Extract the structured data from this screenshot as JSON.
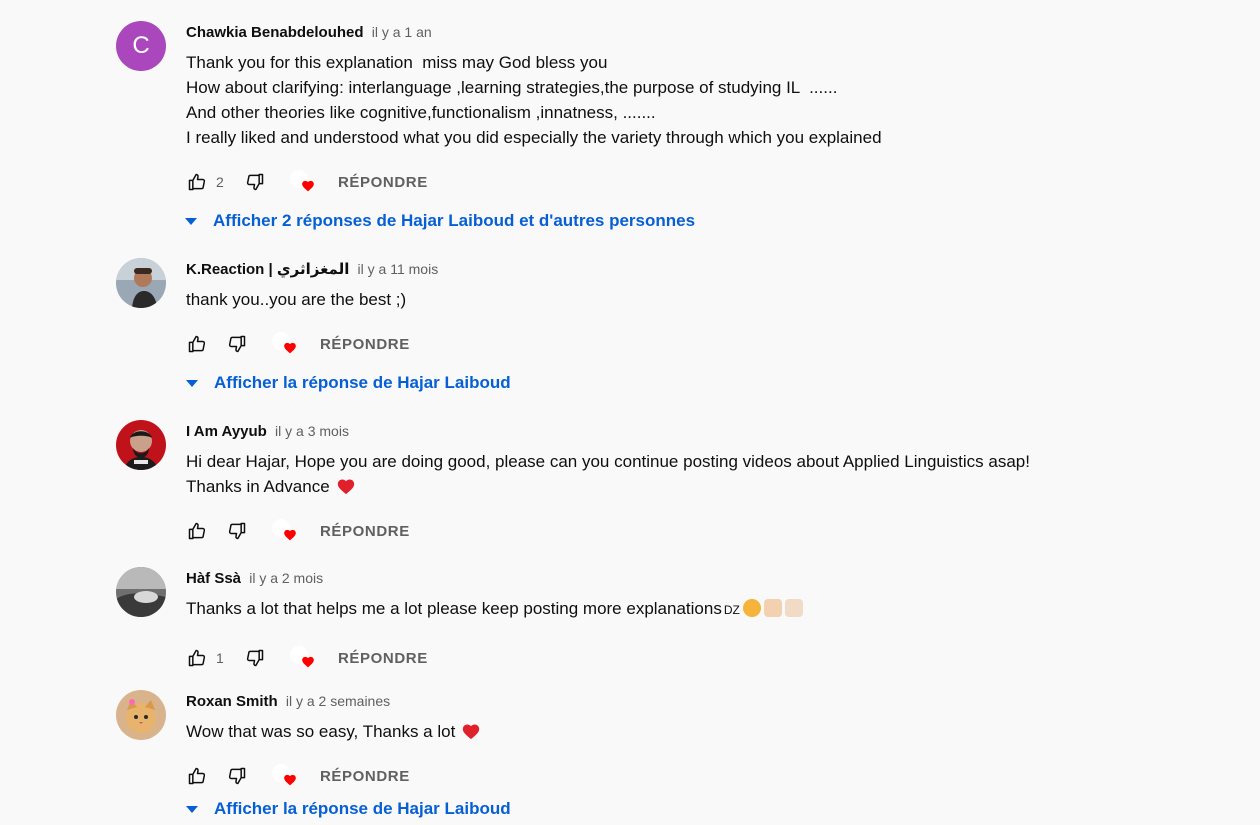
{
  "ui": {
    "reply_label": "RÉPONDRE",
    "accent": "#065fd4"
  },
  "comments": [
    {
      "author": "Chawkia Benabdelouhed",
      "date": "il y a 1 an",
      "avatar_letter": "C",
      "avatar_color": "#ab47bc",
      "text_lines": [
        "Thank you for this explanation  miss may God bless you",
        "How about clarifying: interlanguage ,learning strategies,the purpose of studying IL  ......",
        "And other theories like cognitive,functionalism ,innatness, .......",
        "I really liked and understood what you did especially the variety through which you explained"
      ],
      "likes": "2",
      "replies_label": "Afficher 2 réponses de Hajar Laiboud et d'autres personnes"
    },
    {
      "author": "K.Reaction | المغزاثري",
      "date": "il y a 11 mois",
      "avatar_icon": "person-photo",
      "text_lines": [
        "thank you..you are the best ;)"
      ],
      "likes": "",
      "replies_label": "Afficher la réponse de Hajar Laiboud"
    },
    {
      "author": "I Am Ayyub",
      "date": "il y a 3 mois",
      "avatar_icon": "red-portrait",
      "text_lines": [
        "Hi dear Hajar, Hope you are doing good, please can you continue posting videos about Applied Linguistics asap!",
        "Thanks in Advance"
      ],
      "likes": "",
      "replies_label": ""
    },
    {
      "author": "Hàf Ssà",
      "date": "il y a 2 mois",
      "avatar_icon": "grey-photo",
      "text_lines": [
        "Thanks a lot that helps me a lot please keep posting more explanations"
      ],
      "emoji_suffix": "DZ",
      "likes": "1",
      "replies_label": ""
    },
    {
      "author": "Roxan Smith",
      "date": "il y a 2 semaines",
      "avatar_icon": "cat-photo",
      "text_lines": [
        "Wow that was so easy, Thanks a lot"
      ],
      "likes": "",
      "replies_label": "Afficher la réponse de Hajar Laiboud"
    }
  ]
}
